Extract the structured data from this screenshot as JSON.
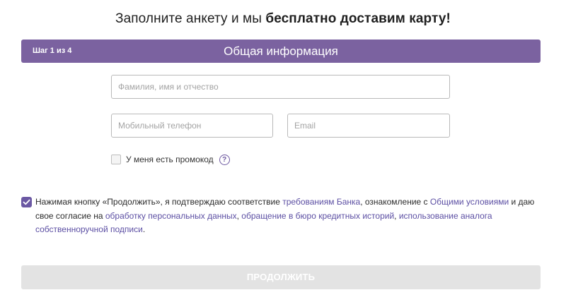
{
  "header": {
    "title_regular": "Заполните анкету и мы ",
    "title_bold": "бесплатно доставим карту!"
  },
  "step_bar": {
    "counter": "Шаг 1 из 4",
    "title": "Общая информация",
    "color": "#7b62a0"
  },
  "form": {
    "full_name": {
      "placeholder": "Фамилия, имя и отчество",
      "value": ""
    },
    "phone": {
      "placeholder": "Мобильный телефон",
      "value": ""
    },
    "email": {
      "placeholder": "Email",
      "value": ""
    },
    "promo": {
      "label": "У меня есть промокод",
      "checked": false,
      "help_icon": "question-icon",
      "help_symbol": "?"
    }
  },
  "consent": {
    "checked": true,
    "check_icon": "checkmark-icon",
    "text_1": "Нажимая кнопку «Продолжить», я подтверждаю соответствие ",
    "link_1": "требованиям Банка",
    "text_2": ", ознакомление с ",
    "link_2": "Общими условиями",
    "text_3": " и даю свое согласие на ",
    "link_3": "обработку персональных данных",
    "text_4": ", ",
    "link_4": "обращение в бюро кредитных историй",
    "text_5": ", ",
    "link_5": "использование аналога собственноручной подписи",
    "text_6": ".",
    "link_color": "#5c4fa3"
  },
  "submit": {
    "label": "ПРОДОЛЖИТЬ",
    "state": "disabled",
    "color": "#e3e3e3"
  }
}
